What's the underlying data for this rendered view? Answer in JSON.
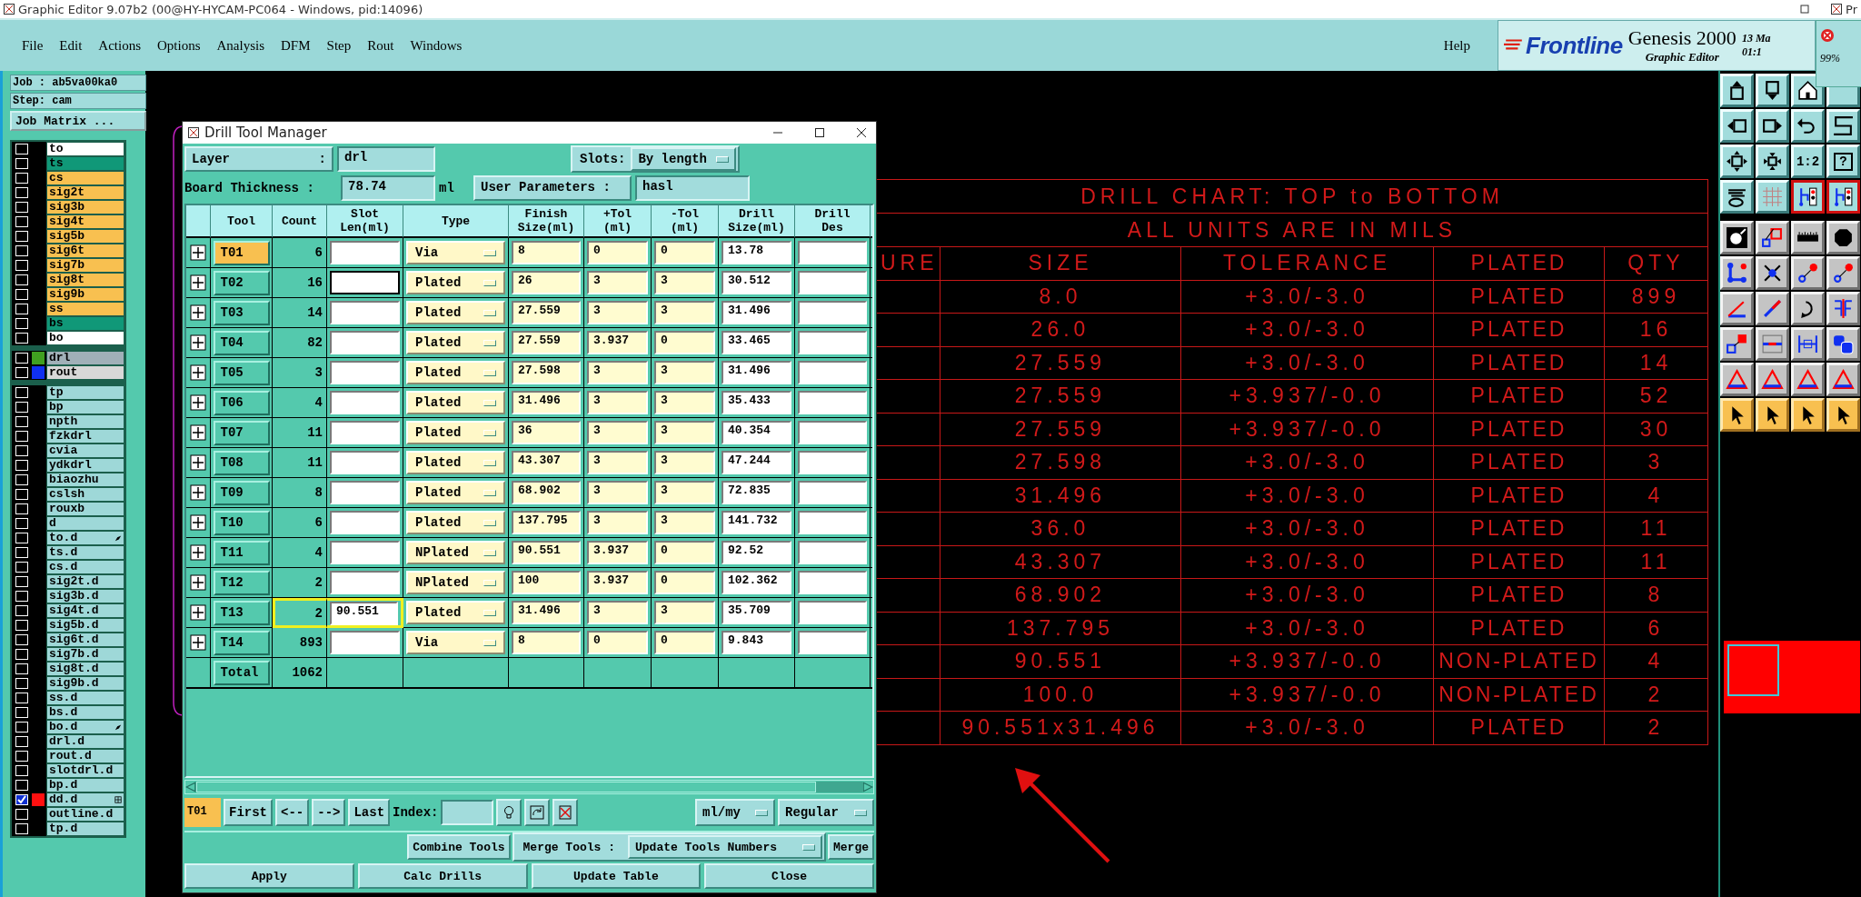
{
  "window": {
    "title": "Graphic Editor 9.07b2 (00@HY-HYCAM-PC064 - Windows, pid:14096)",
    "side_title": "Pr"
  },
  "menu": [
    "File",
    "Edit",
    "Actions",
    "Options",
    "Analysis",
    "DFM",
    "Step",
    "Rout",
    "Windows"
  ],
  "help": "Help",
  "brand": {
    "logo": "Frontline",
    "product": "Genesis 2000",
    "subtitle": "Graphic Editor",
    "date": "13 Ma",
    "time": "01:1"
  },
  "zoom_panel": {
    "reading": "99%"
  },
  "job": {
    "job": "Job : ab5va00ka0",
    "step": "Step: cam",
    "matrix_button": "Job Matrix ..."
  },
  "layer_groups": [
    {
      "layers": [
        {
          "name": "to",
          "color": "#ffffff",
          "selected": false
        },
        {
          "name": "ts",
          "color": "#109878",
          "selected": false
        },
        {
          "name": "cs",
          "color": "#f8c050",
          "selected": false
        },
        {
          "name": "sig2t",
          "color": "#f8c050",
          "selected": false
        },
        {
          "name": "sig3b",
          "color": "#f8c050",
          "selected": false
        },
        {
          "name": "sig4t",
          "color": "#f8c050",
          "selected": false
        },
        {
          "name": "sig5b",
          "color": "#f8c050",
          "selected": false
        },
        {
          "name": "sig6t",
          "color": "#f8c050",
          "selected": false
        },
        {
          "name": "sig7b",
          "color": "#f8c050",
          "selected": false
        },
        {
          "name": "sig8t",
          "color": "#f8c050",
          "selected": false
        },
        {
          "name": "sig9b",
          "color": "#f8c050",
          "selected": false
        },
        {
          "name": "ss",
          "color": "#f8c050",
          "selected": false
        },
        {
          "name": "bs",
          "color": "#109878",
          "selected": false
        },
        {
          "name": "bo",
          "color": "#ffffff",
          "selected": false
        }
      ]
    },
    {
      "layers": [
        {
          "name": "drl",
          "color": "#a0b0b8",
          "selected": false,
          "swatch": {
            "color": "#40a020"
          }
        },
        {
          "name": "rout",
          "color": "#d8d8d8",
          "selected": false,
          "swatch": {
            "color": "#1030f0"
          }
        }
      ]
    },
    {
      "layers": [
        {
          "name": "tp",
          "color": "#9ed8d8",
          "selected": false
        },
        {
          "name": "bp",
          "color": "#9ed8d8",
          "selected": false
        },
        {
          "name": "npth",
          "color": "#9ed8d8",
          "selected": false
        },
        {
          "name": "fzkdrl",
          "color": "#9ed8d8",
          "selected": false
        },
        {
          "name": "cvia",
          "color": "#9ed8d8",
          "selected": false
        },
        {
          "name": "ydkdrl",
          "color": "#9ed8d8",
          "selected": false
        },
        {
          "name": "biaozhu",
          "color": "#9ed8d8",
          "selected": false
        },
        {
          "name": "cslsh",
          "color": "#9ed8d8",
          "selected": false
        },
        {
          "name": "rouxb",
          "color": "#9ed8d8",
          "selected": false
        },
        {
          "name": "d",
          "color": "#9ed8d8",
          "selected": false
        },
        {
          "name": "to.d",
          "color": "#9ed8d8",
          "selected": false,
          "kind": "pointer"
        },
        {
          "name": "ts.d",
          "color": "#9ed8d8",
          "selected": false
        },
        {
          "name": "cs.d",
          "color": "#9ed8d8",
          "selected": false
        },
        {
          "name": "sig2t.d",
          "color": "#9ed8d8",
          "selected": false
        },
        {
          "name": "sig3b.d",
          "color": "#9ed8d8",
          "selected": false
        },
        {
          "name": "sig4t.d",
          "color": "#9ed8d8",
          "selected": false
        },
        {
          "name": "sig5b.d",
          "color": "#9ed8d8",
          "selected": false
        },
        {
          "name": "sig6t.d",
          "color": "#9ed8d8",
          "selected": false
        },
        {
          "name": "sig7b.d",
          "color": "#9ed8d8",
          "selected": false
        },
        {
          "name": "sig8t.d",
          "color": "#9ed8d8",
          "selected": false
        },
        {
          "name": "sig9b.d",
          "color": "#9ed8d8",
          "selected": false
        },
        {
          "name": "ss.d",
          "color": "#9ed8d8",
          "selected": false
        },
        {
          "name": "bs.d",
          "color": "#9ed8d8",
          "selected": false
        },
        {
          "name": "bo.d",
          "color": "#9ed8d8",
          "selected": false,
          "kind": "pointer"
        },
        {
          "name": "drl.d",
          "color": "#9ed8d8",
          "selected": false
        },
        {
          "name": "rout.d",
          "color": "#9ed8d8",
          "selected": false
        },
        {
          "name": "slotdrl.d",
          "color": "#9ed8d8",
          "selected": false
        },
        {
          "name": "bp.d",
          "color": "#9ed8d8",
          "selected": false
        },
        {
          "name": "dd.d",
          "color": "#9ed8d8",
          "selected": true,
          "swatch": {
            "color": "#ff1010"
          },
          "kind": "grid"
        },
        {
          "name": "outline.d",
          "color": "#9ed8d8",
          "selected": false
        },
        {
          "name": "tp.d",
          "color": "#9ed8d8",
          "selected": false
        }
      ]
    }
  ],
  "toolbar": {
    "ratio_label": "1:2",
    "help_label": "?"
  },
  "dialog": {
    "title": "Drill Tool Manager",
    "layer_label": "Layer",
    "layer_sep": ":",
    "layer_value": "drl",
    "slots_label": "Slots:",
    "slots_value": "By length",
    "thickness_label": "Board Thickness :",
    "thickness_value": "78.74",
    "thickness_unit": "ml",
    "user_params_label": "User Parameters :",
    "user_params_value": "hasl",
    "columns": [
      "Tool",
      "Count",
      "Slot\nLen(ml)",
      "Type",
      "Finish\nSize(ml)",
      "+Tol\n(ml)",
      "-Tol\n(ml)",
      "Drill\nSize(ml)",
      "Drill\nDes"
    ],
    "rows": [
      {
        "tool": "T01",
        "selected": true,
        "count": "6",
        "type": "Via",
        "finish": "8",
        "plus_tol": "0",
        "minus_tol": "0",
        "drill_size": "13.78",
        "focused": false,
        "highlighted": false
      },
      {
        "tool": "T02",
        "selected": false,
        "count": "16",
        "type": "Plated",
        "finish": "26",
        "plus_tol": "3",
        "minus_tol": "3",
        "drill_size": "30.512",
        "focused": true,
        "highlighted": false
      },
      {
        "tool": "T03",
        "selected": false,
        "count": "14",
        "type": "Plated",
        "finish": "27.559",
        "plus_tol": "3",
        "minus_tol": "3",
        "drill_size": "31.496",
        "focused": false,
        "highlighted": false
      },
      {
        "tool": "T04",
        "selected": false,
        "count": "82",
        "type": "Plated",
        "finish": "27.559",
        "plus_tol": "3.937",
        "minus_tol": "0",
        "drill_size": "33.465",
        "focused": false,
        "highlighted": false
      },
      {
        "tool": "T05",
        "selected": false,
        "count": "3",
        "type": "Plated",
        "finish": "27.598",
        "plus_tol": "3",
        "minus_tol": "3",
        "drill_size": "31.496",
        "focused": false,
        "highlighted": false
      },
      {
        "tool": "T06",
        "selected": false,
        "count": "4",
        "type": "Plated",
        "finish": "31.496",
        "plus_tol": "3",
        "minus_tol": "3",
        "drill_size": "35.433",
        "focused": false,
        "highlighted": false
      },
      {
        "tool": "T07",
        "selected": false,
        "count": "11",
        "type": "Plated",
        "finish": "36",
        "plus_tol": "3",
        "minus_tol": "3",
        "drill_size": "40.354",
        "focused": false,
        "highlighted": false
      },
      {
        "tool": "T08",
        "selected": false,
        "count": "11",
        "type": "Plated",
        "finish": "43.307",
        "plus_tol": "3",
        "minus_tol": "3",
        "drill_size": "47.244",
        "focused": false,
        "highlighted": false
      },
      {
        "tool": "T09",
        "selected": false,
        "count": "8",
        "type": "Plated",
        "finish": "68.902",
        "plus_tol": "3",
        "minus_tol": "3",
        "drill_size": "72.835",
        "focused": false,
        "highlighted": false
      },
      {
        "tool": "T10",
        "selected": false,
        "count": "6",
        "type": "Plated",
        "finish": "137.795",
        "plus_tol": "3",
        "minus_tol": "3",
        "drill_size": "141.732",
        "focused": false,
        "highlighted": false
      },
      {
        "tool": "T11",
        "selected": false,
        "count": "4",
        "type": "NPlated",
        "finish": "90.551",
        "plus_tol": "3.937",
        "minus_tol": "0",
        "drill_size": "92.52",
        "focused": false,
        "highlighted": false
      },
      {
        "tool": "T12",
        "selected": false,
        "count": "2",
        "type": "NPlated",
        "finish": "100",
        "plus_tol": "3.937",
        "minus_tol": "0",
        "drill_size": "102.362",
        "focused": false,
        "highlighted": false
      },
      {
        "tool": "T13",
        "selected": false,
        "count": "2",
        "slot_len": "90.551",
        "type": "Plated",
        "finish": "31.496",
        "plus_tol": "3",
        "minus_tol": "3",
        "drill_size": "35.709",
        "focused": false,
        "highlighted": true
      },
      {
        "tool": "T14",
        "selected": false,
        "count": "893",
        "type": "Via",
        "finish": "8",
        "plus_tol": "0",
        "minus_tol": "0",
        "drill_size": "9.843",
        "focused": false,
        "highlighted": false
      }
    ],
    "total_label": "Total",
    "total_count": "1062",
    "current_tool": "T01",
    "nav_buttons": [
      "First",
      "<--",
      "-->",
      "Last"
    ],
    "index_label": "Index:",
    "units": "ml/my",
    "mode": "Regular",
    "combine_button": "Combine Tools",
    "merge_label": "Merge Tools :",
    "merge_option": "Update Tools Numbers",
    "merge_button": "Merge",
    "actions": [
      "Apply",
      "Calc Drills",
      "Update Table",
      "Close"
    ]
  },
  "drill_chart": {
    "title": "DRILL CHART: TOP to BOTTOM",
    "note": "ALL UNITS ARE IN MILS",
    "columns": [
      "URE",
      "SIZE",
      "TOLERANCE",
      "PLATED",
      "QTY"
    ],
    "rows": [
      [
        "",
        "8.0",
        "+3.0/-3.0",
        "PLATED",
        "899"
      ],
      [
        "",
        "26.0",
        "+3.0/-3.0",
        "PLATED",
        "16"
      ],
      [
        "",
        "27.559",
        "+3.0/-3.0",
        "PLATED",
        "14"
      ],
      [
        "",
        "27.559",
        "+3.937/-0.0",
        "PLATED",
        "52"
      ],
      [
        "",
        "27.559",
        "+3.937/-0.0",
        "PLATED",
        "30"
      ],
      [
        "",
        "27.598",
        "+3.0/-3.0",
        "PLATED",
        "3"
      ],
      [
        "",
        "31.496",
        "+3.0/-3.0",
        "PLATED",
        "4"
      ],
      [
        "",
        "36.0",
        "+3.0/-3.0",
        "PLATED",
        "11"
      ],
      [
        "",
        "43.307",
        "+3.0/-3.0",
        "PLATED",
        "11"
      ],
      [
        "",
        "68.902",
        "+3.0/-3.0",
        "PLATED",
        "8"
      ],
      [
        "",
        "137.795",
        "+3.0/-3.0",
        "PLATED",
        "6"
      ],
      [
        "",
        "90.551",
        "+3.937/-0.0",
        "NON-PLATED",
        "4"
      ],
      [
        "",
        "100.0",
        "+3.937/-0.0",
        "NON-PLATED",
        "2"
      ],
      [
        "",
        "90.551x31.496",
        "+3.0/-3.0",
        "PLATED",
        "2"
      ]
    ]
  }
}
